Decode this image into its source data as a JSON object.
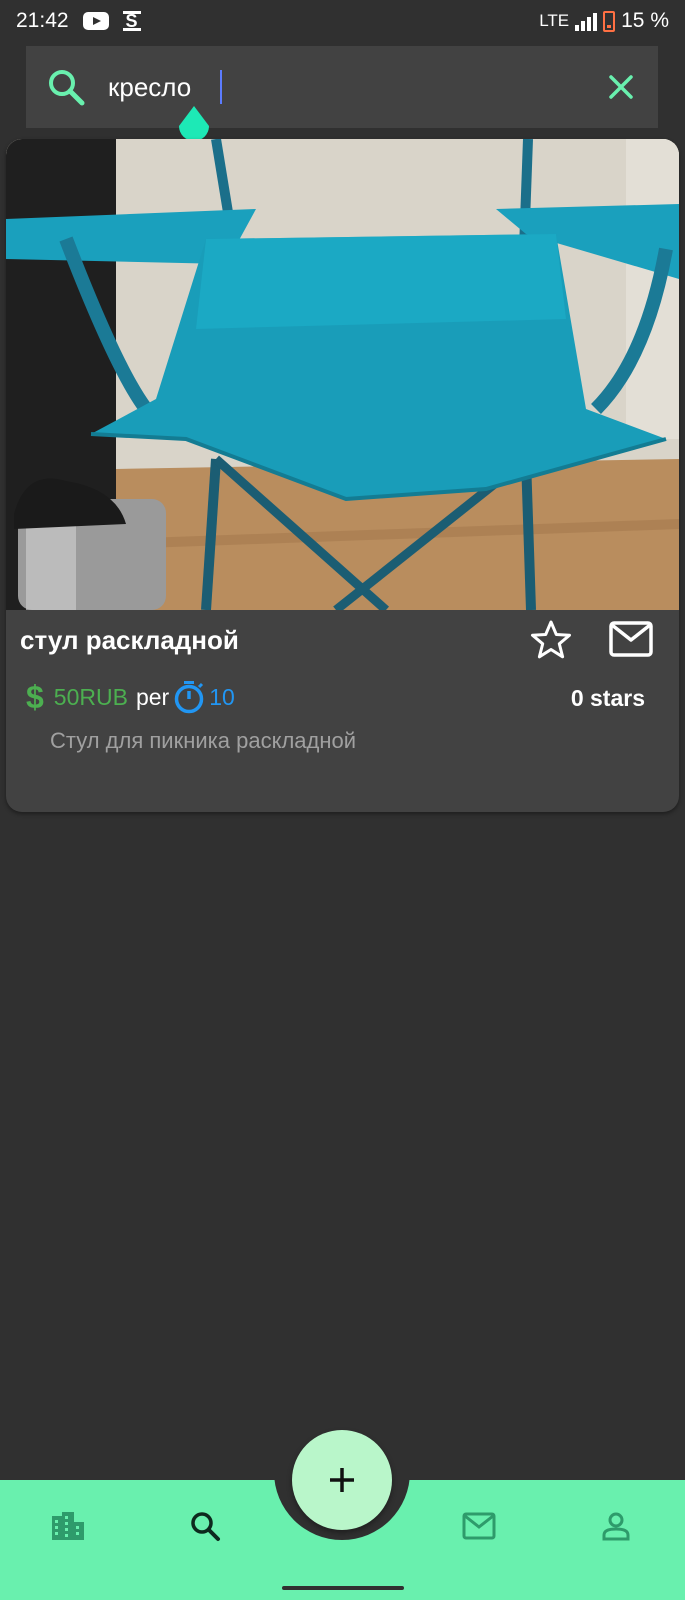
{
  "status_bar": {
    "time": "21:42",
    "network": "LTE",
    "battery": "15 %",
    "icons": [
      "youtube-icon",
      "s-app-icon",
      "signal-icon",
      "battery-icon"
    ]
  },
  "search": {
    "value": "кресло",
    "icon": "search-icon",
    "clear_icon": "close-icon"
  },
  "listing": {
    "title": "стул раскладной",
    "currency_icon": "dollar-icon",
    "price": "50RUB",
    "per_label": "per",
    "period_icon": "timer-icon",
    "period_value": "10",
    "stars": "0 stars",
    "description": "Стул для пикника раскладной",
    "image": "photo of a teal folding camping chair next to a thermos"
  },
  "bottom_nav": {
    "items": [
      "apartment-icon",
      "search-icon",
      "mail-icon",
      "person-icon"
    ],
    "fab_icon": "plus-icon"
  },
  "colors": {
    "background": "#303030",
    "surface": "#424242",
    "accent": "#69f0ae",
    "price": "#4caf50",
    "period": "#2196f3"
  }
}
